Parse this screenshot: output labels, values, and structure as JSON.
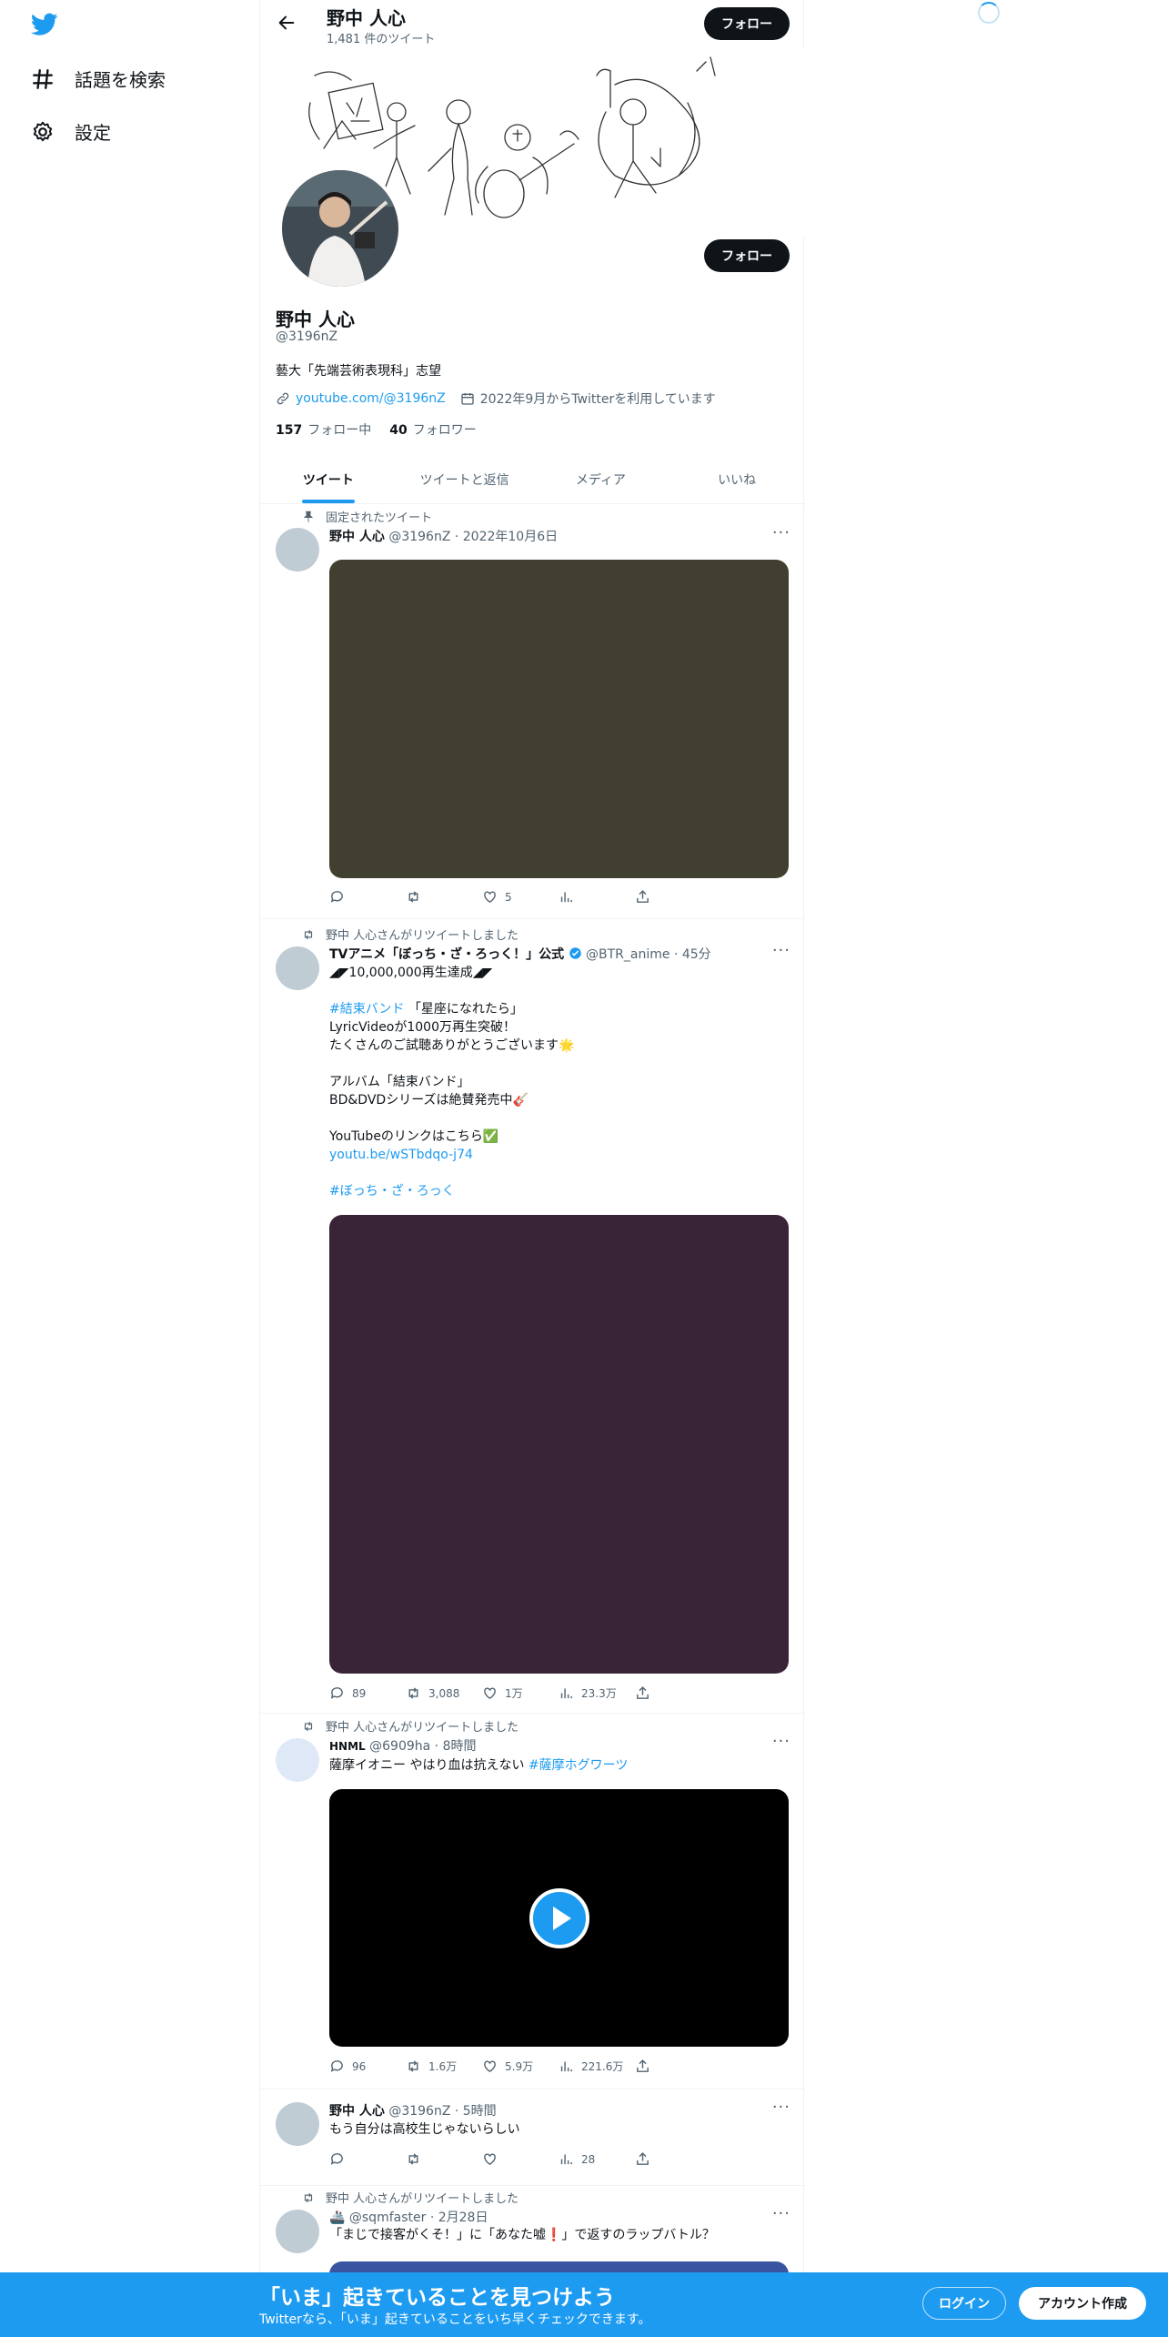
{
  "sidebar": {
    "items": [
      {
        "label": "話題を検索",
        "icon": "hashtag-icon"
      },
      {
        "label": "設定",
        "icon": "gear-icon"
      }
    ]
  },
  "header": {
    "name": "野中 人心",
    "tweet_count": "1,481 件のツイート",
    "follow_label": "フォロー"
  },
  "profile": {
    "name": "野中 人心",
    "handle": "@3196nZ",
    "bio": "藝大「先端芸術表現科」志望",
    "link": "youtube.com/@3196nZ",
    "joined": "2022年9月からTwitterを利用しています",
    "following_count": "157",
    "following_label": "フォロー中",
    "followers_count": "40",
    "followers_label": "フォロワー",
    "follow_label": "フォロー"
  },
  "tabs": [
    {
      "label": "ツイート",
      "active": true
    },
    {
      "label": "ツイートと返信",
      "active": false
    },
    {
      "label": "メディア",
      "active": false
    },
    {
      "label": "いいね",
      "active": false
    }
  ],
  "tweets": [
    {
      "social": "固定されたツイート",
      "name": "野中 人心",
      "meta": "@3196nZ · 2022年10月6日",
      "media_color": "#414030",
      "reply": "",
      "retweet": "",
      "like": "5",
      "views": ""
    },
    {
      "social": "野中 人心さんがリツイートしました",
      "name": "TVアニメ「ぼっち・ざ・ろっく！」公式",
      "meta": "@BTR_anime · 45分",
      "text_1": "◢◤10,000,000再生達成◢◤",
      "hashtag_1": "#結束バンド",
      "text_2": " 「星座になれたら」\nLyricVideoが1000万再生突破！\nたくさんのご試聴ありがとうございます🌟\n\nアルバム「結束バンド」\nBD&DVDシリーズは絶賛発売中🎸\n\nYouTubeのリンクはこちら✅",
      "link": "youtu.be/wSTbdqo-j74",
      "hashtag_2": "#ぼっち・ざ・ろっく",
      "media_color": "#382436",
      "reply": "89",
      "retweet": "3,088",
      "like": "1万",
      "views": "23.3万"
    },
    {
      "social": "野中 人心さんがリツイートしました",
      "name": "HNML",
      "meta": "@6909ha · 8時間",
      "text": "薩摩イオニー やはり血は抗えない ",
      "hashtag": "#薩摩ホグワーツ",
      "media_color": "#000000",
      "reply": "96",
      "retweet": "1.6万",
      "like": "5.9万",
      "views": "221.6万"
    },
    {
      "social": "",
      "name": "野中 人心",
      "meta": "@3196nZ · 5時間",
      "text": "もう自分は高校生じゃないらしい",
      "reply": "",
      "retweet": "",
      "like": "",
      "views": "28"
    },
    {
      "social": "野中 人心さんがリツイートしました",
      "name": "🚢",
      "meta": "@sqmfaster · 2月28日",
      "text": "「まじで接客がくそ！」に「あなた嘘❗」で返すのラップバトル？",
      "media_color": "#3a55a0"
    }
  ],
  "bottom_bar": {
    "title": "「いま」起きていることを見つけよう",
    "subtitle": "Twitterなら、「いま」起きていることをいち早くチェックできます。",
    "login_label": "ログイン",
    "signup_label": "アカウント作成"
  },
  "colors": {
    "accent": "#1d9bf0",
    "text": "#0f1419",
    "muted": "#536471"
  }
}
